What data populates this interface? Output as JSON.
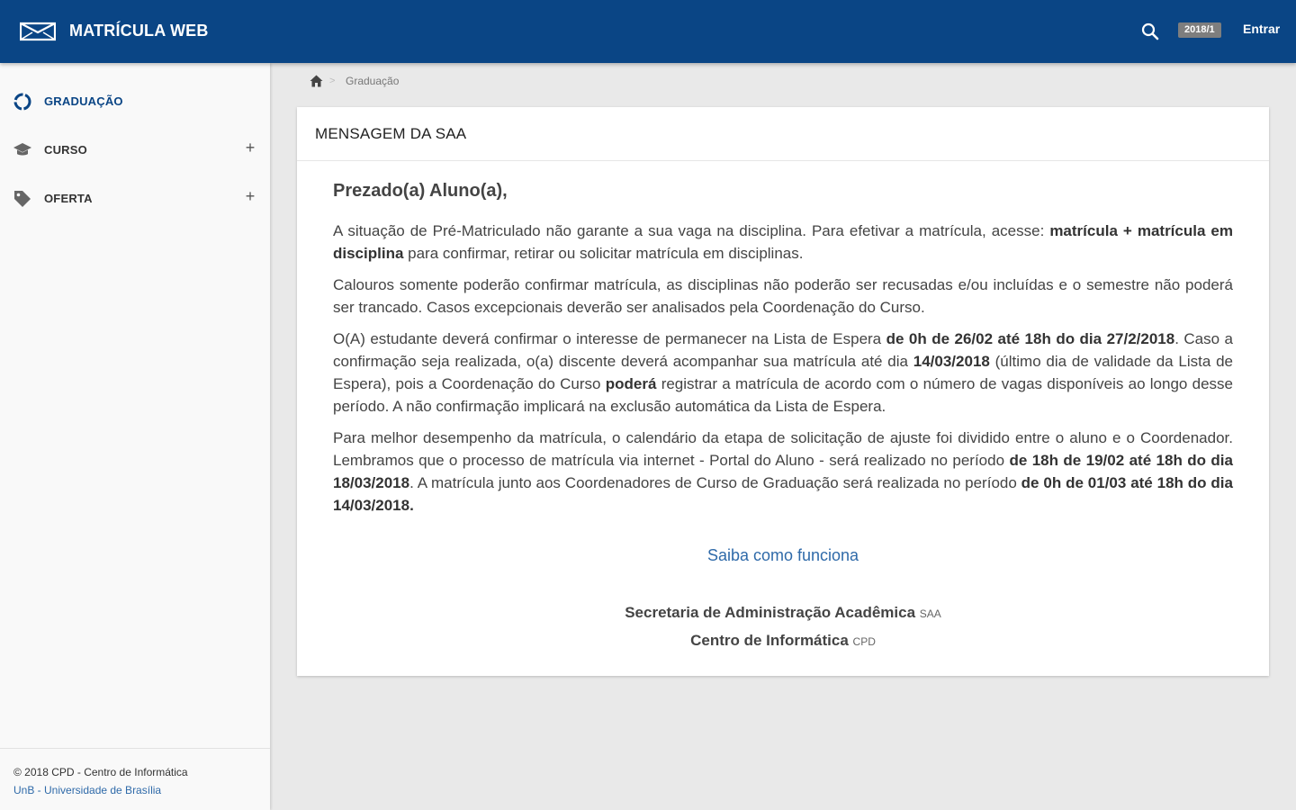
{
  "header": {
    "app_title": "MATRÍCULA WEB",
    "semester": "2018/1",
    "login_label": "Entrar",
    "brand_color": "#0a4585"
  },
  "sidebar": {
    "items": [
      {
        "label": "GRADUAÇÃO",
        "icon": "graduation-circle-icon",
        "active": true
      },
      {
        "label": "CURSO",
        "icon": "mortarboard-icon",
        "expand": "+"
      },
      {
        "label": "OFERTA",
        "icon": "tag-icon",
        "expand": "+"
      }
    ],
    "footer": {
      "copyright": "© 2018 CPD - Centro de Informática",
      "university": "UnB - Universidade de Brasília"
    }
  },
  "breadcrumb": {
    "separator": ">",
    "current": "Graduação"
  },
  "message": {
    "title": "MENSAGEM DA SAA",
    "greeting": "Prezado(a) Aluno(a),",
    "p1": {
      "a": "A situação de Pré-Matriculado não garante a sua vaga na disciplina. Para efetivar a matrícula, acesse: ",
      "b": "matrícula + matrícula em disciplina",
      "c": " para confirmar, retirar ou solicitar matrícula em disciplinas."
    },
    "p2": "Calouros somente poderão confirmar matrícula, as disciplinas não poderão ser recusadas e/ou incluídas e o semestre não poderá ser trancado. Casos excepcionais deverão ser analisados pela Coordenação do Curso.",
    "p3": {
      "a": "O(A) estudante deverá confirmar o interesse de permanecer na Lista de Espera ",
      "b": "de 0h de 26/02 até 18h do dia 27/2/2018",
      "c": ". Caso a confirmação seja realizada, o(a) discente deverá acompanhar sua matrícula até dia ",
      "d": "14/03/2018",
      "e": " (último dia de validade da Lista de Espera), pois a Coordenação do Curso ",
      "f": "poderá",
      "g": " registrar a matrícula de acordo com o número de vagas disponíveis ao longo desse período. A não confirmação implicará na exclusão automática da Lista de Espera."
    },
    "p4": {
      "a": "Para melhor desempenho da matrícula, o calendário da etapa de solicitação de ajuste foi dividido entre o aluno e o Coordenador. Lembramos que o processo de matrícula via internet - Portal do Aluno - será realizado no período ",
      "b": "de 18h de 19/02 até 18h do dia 18/03/2018",
      "c": ". A matrícula junto aos Coordenadores de Curso de Graduação será realizada no período ",
      "d": "de 0h de 01/03 até 18h do dia 14/03/2018."
    },
    "link_label": "Saiba como funciona",
    "signature": [
      {
        "name": "Secretaria de Administração Acadêmica",
        "abbr": "SAA"
      },
      {
        "name": "Centro de Informática",
        "abbr": "CPD"
      }
    ]
  }
}
